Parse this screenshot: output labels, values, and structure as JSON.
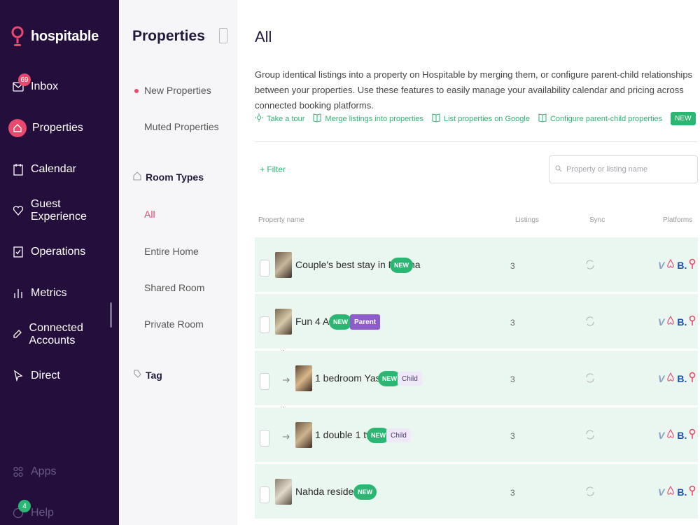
{
  "nav": {
    "brand": "hospitable",
    "items": [
      {
        "id": "inbox",
        "label": "Inbox",
        "badge": "69"
      },
      {
        "id": "properties",
        "label": "Properties"
      },
      {
        "id": "calendar",
        "label": "Calendar"
      },
      {
        "id": "guest-experience",
        "label": "Guest Experience"
      },
      {
        "id": "operations",
        "label": "Operations"
      },
      {
        "id": "metrics",
        "label": "Metrics"
      },
      {
        "id": "connected-accounts",
        "label": "Connected Accounts"
      },
      {
        "id": "direct",
        "label": "Direct"
      },
      {
        "id": "apps",
        "label": "Apps"
      },
      {
        "id": "help",
        "label": "Help",
        "badge": "4"
      }
    ]
  },
  "sub": {
    "title": "Properties",
    "items": [
      "New Properties",
      "Muted Properties"
    ],
    "room_types_label": "Room Types",
    "room_types": [
      "All",
      "Entire Home",
      "Shared Room",
      "Private Room"
    ],
    "tag_label": "Tag"
  },
  "main": {
    "title": "All",
    "description": "Group identical listings into a property on Hospitable by merging them, or configure parent-child relationships between your properties. Use these features to easily manage your availability calendar and pricing across connected booking platforms.",
    "links": [
      "Take a tour",
      "Merge listings into properties",
      "List properties on Google",
      "Configure parent-child properties"
    ],
    "new_tag": "NEW",
    "filter_label": "+ Filter",
    "search_placeholder": "Property or listing name",
    "columns": {
      "name": "Property name",
      "listings": "Listings",
      "sync": "Sync",
      "platforms": "Platforms"
    },
    "rows": [
      {
        "name": "Couple's best stay in Medina",
        "new": "NEW",
        "listings": "3"
      },
      {
        "name": "Fun 4 All",
        "new": "NEW",
        "role": "Parent",
        "listings": "3"
      },
      {
        "name": "1 bedroom Yasmin",
        "new": "NEW",
        "role": "Child",
        "listings": "3"
      },
      {
        "name": "1 double 1 twin",
        "new": "NEW",
        "role": "Child",
        "listings": "3"
      },
      {
        "name": "Nahda residence",
        "new": "NEW",
        "listings": "3"
      }
    ],
    "platform_b": "B."
  },
  "colors": {
    "nav_bg": "#230e3c",
    "accent": "#e9496f",
    "green": "#2bb673",
    "row_bg": "#eaf7f0",
    "parent": "#8d5cc8"
  }
}
